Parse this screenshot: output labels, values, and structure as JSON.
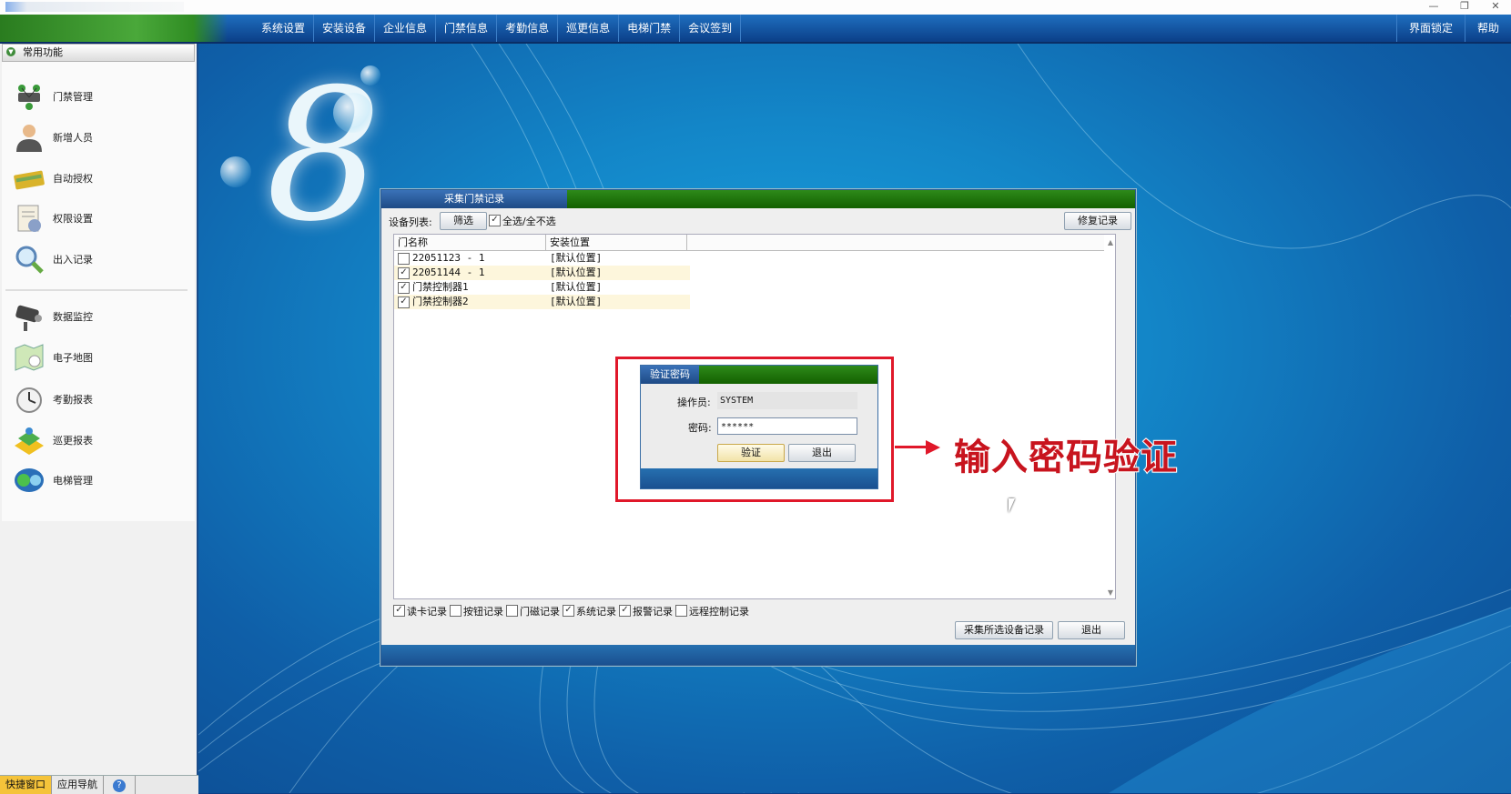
{
  "window": {
    "controls": [
      "—",
      "❐",
      "✕"
    ]
  },
  "menu": {
    "items": [
      "系统设置",
      "安装设备",
      "企业信息",
      "门禁信息",
      "考勤信息",
      "巡更信息",
      "电梯门禁",
      "会议签到"
    ],
    "right": [
      "界面锁定",
      "帮助"
    ]
  },
  "sidebar": {
    "header": "常用功能",
    "items": [
      {
        "label": "门禁管理",
        "icon": "door-controller-icon"
      },
      {
        "label": "新增人员",
        "icon": "person-icon"
      },
      {
        "label": "自动授权",
        "icon": "card-icon"
      },
      {
        "label": "权限设置",
        "icon": "permission-icon"
      },
      {
        "label": "出入记录",
        "icon": "magnifier-icon"
      },
      {
        "label": "数据监控",
        "icon": "camera-icon"
      },
      {
        "label": "电子地图",
        "icon": "map-icon"
      },
      {
        "label": "考勤报表",
        "icon": "clock-icon"
      },
      {
        "label": "巡更报表",
        "icon": "patrol-icon"
      },
      {
        "label": "电梯管理",
        "icon": "elevator-icon"
      }
    ]
  },
  "bottom_tabs": [
    "快捷窗口",
    "应用导航",
    "?"
  ],
  "collect": {
    "title": "采集门禁记录",
    "device_list_label": "设备列表:",
    "filter_button": "筛选",
    "select_all": "全选/全不选",
    "repair_button": "修复记录",
    "columns": [
      "门名称",
      "安装位置"
    ],
    "rows": [
      {
        "name": "22051123 - 1",
        "location": "[默认位置]",
        "checked": false
      },
      {
        "name": "22051144 - 1",
        "location": "[默认位置]",
        "checked": true
      },
      {
        "name": "门禁控制器1",
        "location": "[默认位置]",
        "checked": true
      },
      {
        "name": "门禁控制器2",
        "location": "[默认位置]",
        "checked": true
      }
    ],
    "record_types": [
      {
        "label": "读卡记录",
        "checked": true
      },
      {
        "label": "按钮记录",
        "checked": false
      },
      {
        "label": "门磁记录",
        "checked": false
      },
      {
        "label": "系统记录",
        "checked": true
      },
      {
        "label": "报警记录",
        "checked": true
      },
      {
        "label": "远程控制记录",
        "checked": false
      }
    ],
    "collect_button": "采集所选设备记录",
    "exit_button": "退出"
  },
  "verify": {
    "title": "验证密码",
    "operator_label": "操作员:",
    "operator_value": "SYSTEM",
    "password_label": "密码:",
    "password_value": "******",
    "verify_button": "验证",
    "exit_button": "退出"
  },
  "annotation": {
    "text": "输入密码验证",
    "color": "#e0182a"
  },
  "colors": {
    "menu_bar": "#0b3f88",
    "title_green": "#136100",
    "highlight": "#f5c33a"
  }
}
